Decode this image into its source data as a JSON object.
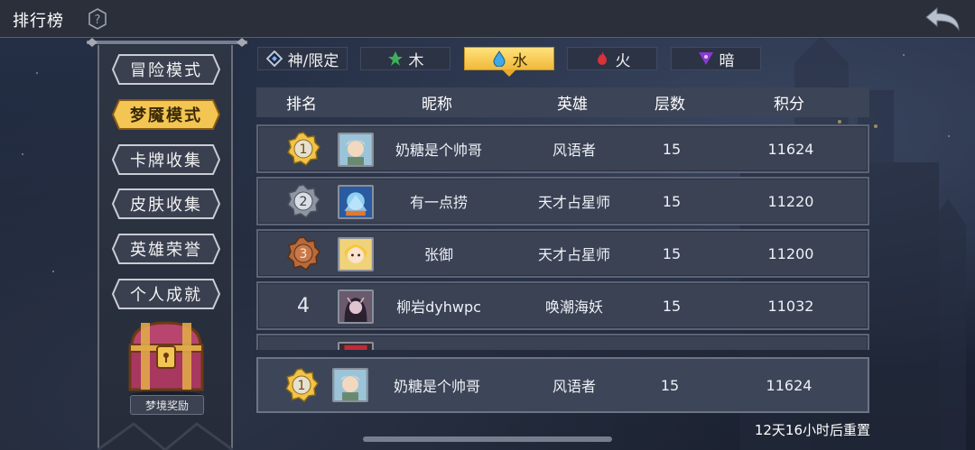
{
  "header": {
    "title": "排行榜"
  },
  "modes": [
    {
      "label": "冒险模式",
      "active": false
    },
    {
      "label": "梦魇模式",
      "active": true
    },
    {
      "label": "卡牌收集",
      "active": false
    },
    {
      "label": "皮肤收集",
      "active": false
    },
    {
      "label": "英雄荣誉",
      "active": false
    },
    {
      "label": "个人成就",
      "active": false
    }
  ],
  "reward": {
    "label": "梦境奖励"
  },
  "element_tabs": [
    {
      "label": "神/限定",
      "icon": "diamond-icon",
      "active": false
    },
    {
      "label": "木",
      "icon": "leaf-icon",
      "active": false
    },
    {
      "label": "水",
      "icon": "water-drop-icon",
      "active": true
    },
    {
      "label": "火",
      "icon": "fire-icon",
      "active": false
    },
    {
      "label": "暗",
      "icon": "dark-triangle-icon",
      "active": false
    }
  ],
  "table": {
    "columns": [
      "排名",
      "昵称",
      "英雄",
      "层数",
      "积分"
    ],
    "rows": [
      {
        "rank": "1",
        "nickname": "奶糖是个帅哥",
        "hero": "风语者",
        "floors": "15",
        "score": "11624"
      },
      {
        "rank": "2",
        "nickname": "有一点捞",
        "hero": "天才占星师",
        "floors": "15",
        "score": "11220"
      },
      {
        "rank": "3",
        "nickname": "张御",
        "hero": "天才占星师",
        "floors": "15",
        "score": "11200"
      },
      {
        "rank": "4",
        "nickname": "柳岩dyhwpc",
        "hero": "唤潮海妖",
        "floors": "15",
        "score": "11032"
      }
    ]
  },
  "my_entry": {
    "rank": "1",
    "nickname": "奶糖是个帅哥",
    "hero": "风语者",
    "floors": "15",
    "score": "11624"
  },
  "footer": {
    "reset_text": "12天16小时后重置"
  },
  "colors": {
    "gold": "#f0b93a",
    "panel": "#3a4254",
    "header": "#3c4457"
  }
}
